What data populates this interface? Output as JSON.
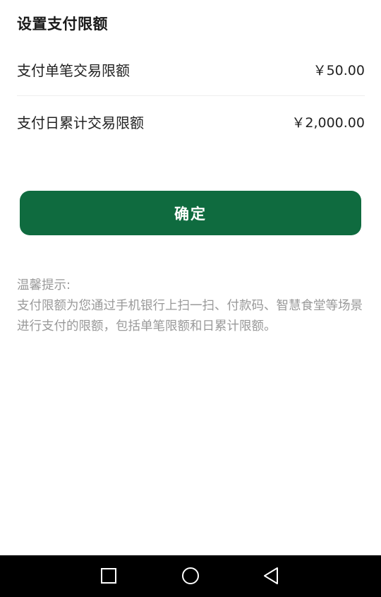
{
  "page": {
    "title": "设置支付限额"
  },
  "limits": [
    {
      "label": "支付单笔交易限额",
      "value": "￥50.00"
    },
    {
      "label": "支付日累计交易限额",
      "value": "￥2,000.00"
    }
  ],
  "confirm_button": {
    "label": "确定"
  },
  "tips": {
    "heading": "温馨提示:",
    "body": "支付限额为您通过手机银行上扫一扫、付款码、智慧食堂等场景进行支付的限额，包括单笔限额和日累计限额。"
  },
  "navigation": {
    "icons": [
      "square-recent-apps-icon",
      "circle-home-icon",
      "triangle-back-icon"
    ]
  },
  "colors": {
    "accent": "#0f6b3f",
    "tips_text": "#999999",
    "nav_background": "#000000"
  }
}
